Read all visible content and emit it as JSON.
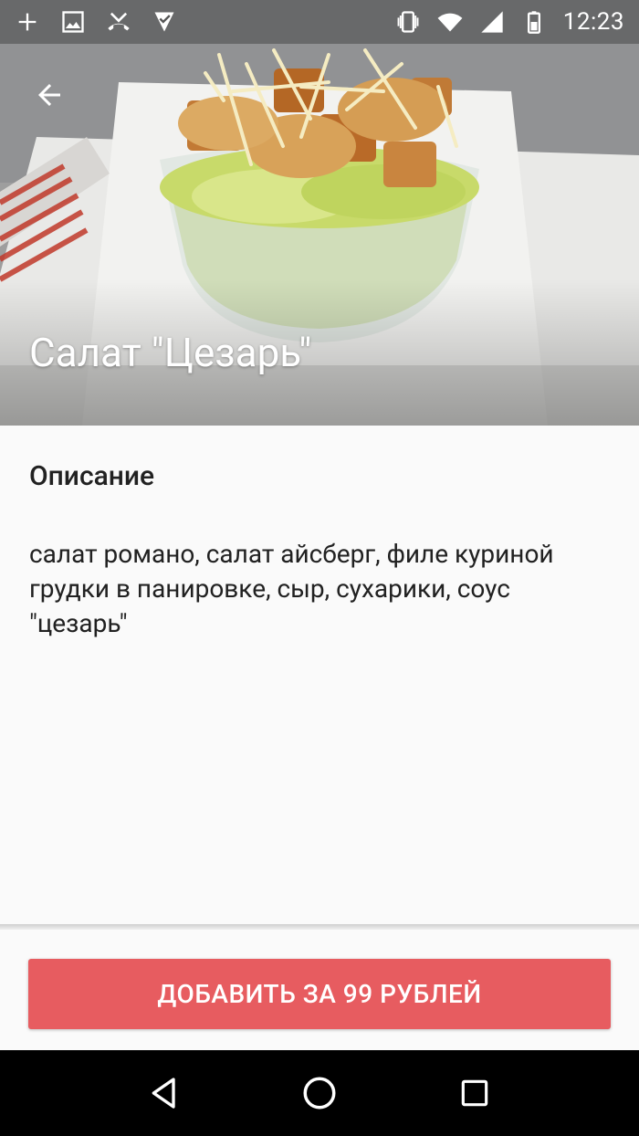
{
  "status_bar": {
    "time": "12:23",
    "left_icons": [
      "plus-icon",
      "image-icon",
      "missed-call-icon",
      "download-check-icon"
    ],
    "right_icons": [
      "vibrate-icon",
      "wifi-icon",
      "signal-icon",
      "battery-icon"
    ]
  },
  "toolbar": {
    "back_icon": "arrow-back-icon"
  },
  "dish": {
    "title": "Салат \"Цезарь\"",
    "section_heading": "Описание",
    "description": "салат романо, салат айсберг, филе куриной грудки в панировке, сыр, сухарики, соус \"цезарь\""
  },
  "action": {
    "add_label": "ДОБАВИТЬ ЗА 99 РУБЛЕЙ",
    "color": "#e75c60"
  },
  "nav_bar": {
    "icons": [
      "back-triangle-icon",
      "home-circle-icon",
      "recents-square-icon"
    ]
  }
}
